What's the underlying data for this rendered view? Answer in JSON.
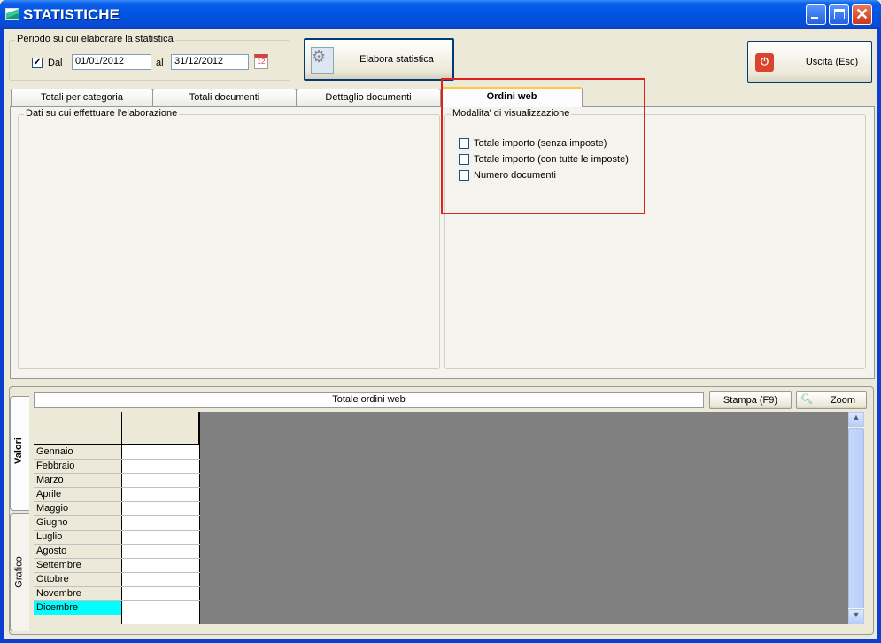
{
  "window": {
    "title": "STATISTICHE"
  },
  "period": {
    "label": "Periodo su cui elaborare la statistica",
    "from_checked": true,
    "from_label": "Dal",
    "from_value": "01/01/2012",
    "to_label": "al",
    "to_value": "31/12/2012"
  },
  "toolbar": {
    "elabora_label": "Elabora statistica",
    "exit_label": "Uscita (Esc)"
  },
  "tabs": [
    {
      "label": "Totali per categoria"
    },
    {
      "label": "Totali documenti"
    },
    {
      "label": "Dettaglio documenti"
    },
    {
      "label": "Ordini web",
      "selected": true
    }
  ],
  "left_group": {
    "label": "Dati su cui effettuare l'elaborazione"
  },
  "right_group": {
    "label": "Modalita' di visualizzazione",
    "options": [
      {
        "label": "Totale importo (senza imposte)",
        "checked": false
      },
      {
        "label": "Totale importo (con tutte le imposte)",
        "checked": false
      },
      {
        "label": "Numero documenti",
        "checked": false
      }
    ]
  },
  "highlight_color": "#e02020",
  "results": {
    "title": "Totale ordini web",
    "print_label": "Stampa (F9)",
    "zoom_label": "Zoom",
    "side_tabs": [
      {
        "label": "Valori",
        "selected": true
      },
      {
        "label": "Grafico"
      }
    ],
    "months": [
      "Gennaio",
      "Febbraio",
      "Marzo",
      "Aprile",
      "Maggio",
      "Giugno",
      "Luglio",
      "Agosto",
      "Settembre",
      "Ottobre",
      "Novembre",
      "Dicembre"
    ],
    "selected_month": "Dicembre",
    "selected_color": "#00ffff"
  }
}
